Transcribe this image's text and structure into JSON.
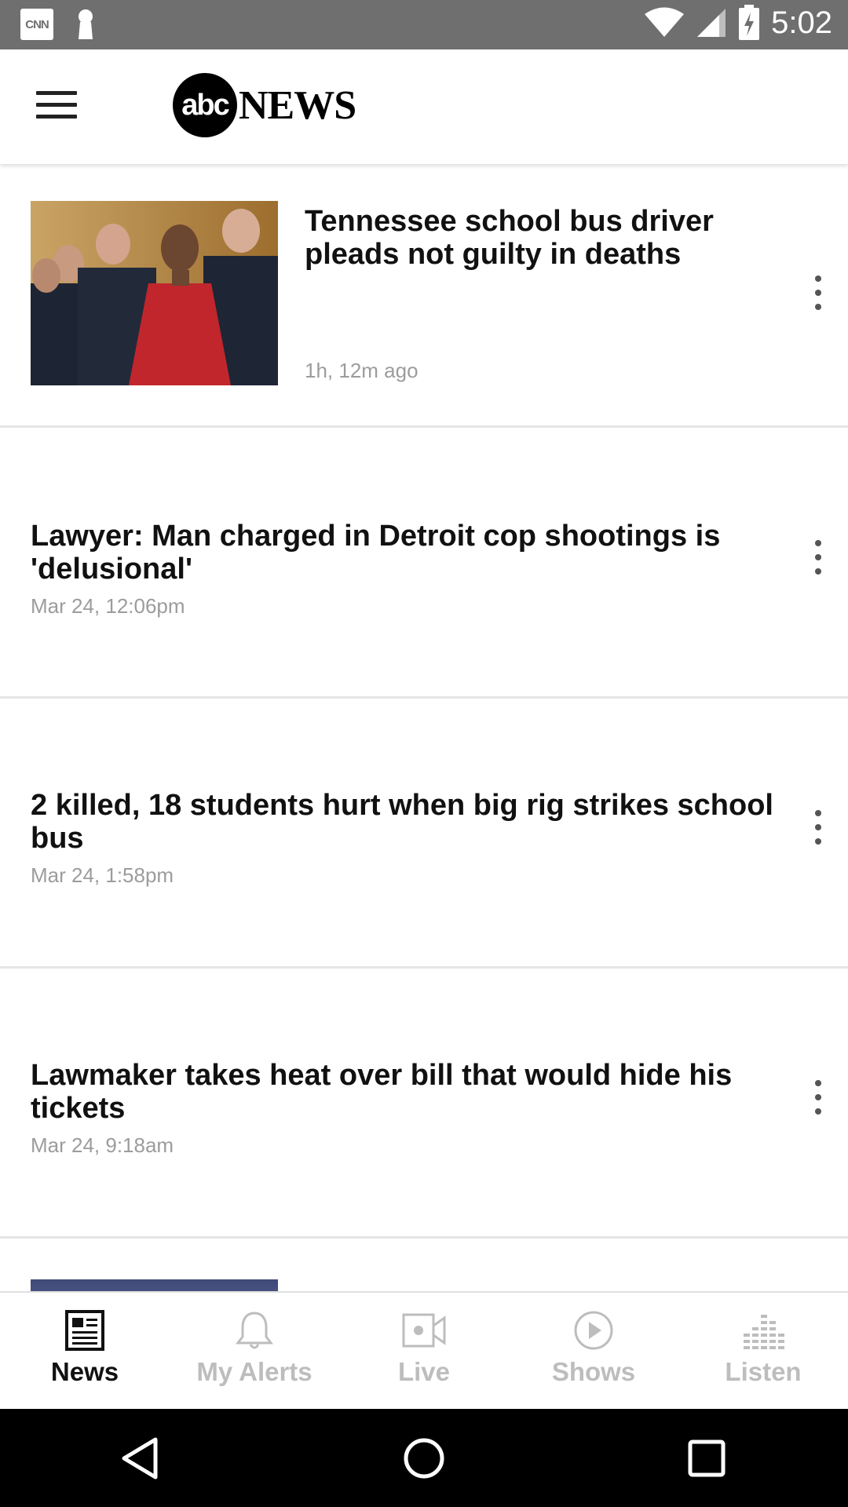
{
  "status_bar": {
    "left_icons": [
      "cnn-notification-icon",
      "keyhole-notification-icon"
    ],
    "cnn_badge": "CNN",
    "right_icons": [
      "wifi-icon",
      "cell-signal-icon",
      "battery-charging-icon"
    ],
    "time": "5:02"
  },
  "app_bar": {
    "logo_mark": "abc",
    "logo_text": "NEWS",
    "menu_icon": "hamburger-menu-icon"
  },
  "stories": [
    {
      "title": "Tennessee school bus driver pleads not guilty in deaths",
      "time": "1h, 12m ago",
      "has_image": true
    },
    {
      "title": "Lawyer: Man charged in Detroit cop shootings is 'delusional'",
      "time": "Mar 24, 12:06pm",
      "has_image": false
    },
    {
      "title": "2 killed, 18 students hurt when big rig strikes school bus",
      "time": "Mar 24, 1:58pm",
      "has_image": false
    },
    {
      "title": "Lawmaker takes heat over bill that would hide his tickets",
      "time": "Mar 24, 9:18am",
      "has_image": false
    }
  ],
  "bottom_nav": {
    "items": [
      {
        "label": "News",
        "icon": "newspaper-icon",
        "active": true
      },
      {
        "label": "My Alerts",
        "icon": "bell-icon",
        "active": false
      },
      {
        "label": "Live",
        "icon": "video-camera-icon",
        "active": false
      },
      {
        "label": "Shows",
        "icon": "play-circle-icon",
        "active": false
      },
      {
        "label": "Listen",
        "icon": "audio-bars-icon",
        "active": false
      }
    ]
  },
  "system_nav": [
    "back-icon",
    "home-icon",
    "recents-icon"
  ],
  "colors": {
    "status_bar": "#6f6f6f",
    "active_nav": "#111111",
    "inactive_nav": "#bdbdbd",
    "timestamp": "#9c9c9c"
  }
}
